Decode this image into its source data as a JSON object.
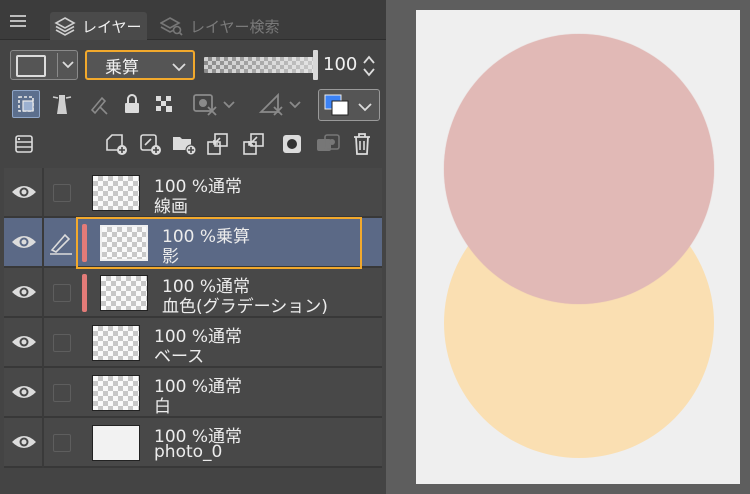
{
  "tabs": [
    {
      "label": "レイヤー",
      "active": true
    },
    {
      "label": "レイヤー検索",
      "active": false
    }
  ],
  "property": {
    "blend_mode": "乗算",
    "opacity": "100",
    "opacity_fraction": 1.0
  },
  "layers": [
    {
      "opacity_mode": "100 %通常",
      "name": "線画",
      "selected": false,
      "thumb": "checker"
    },
    {
      "opacity_mode": "100 %乗算",
      "name": "影",
      "selected": true,
      "thumb": "checker"
    },
    {
      "opacity_mode": "100 %通常",
      "name": "血色(グラデーション)",
      "selected": false,
      "thumb": "checker"
    },
    {
      "opacity_mode": "100 %通常",
      "name": "ベース",
      "selected": false,
      "thumb": "checker"
    },
    {
      "opacity_mode": "100 %通常",
      "name": "白",
      "selected": false,
      "thumb": "checker"
    },
    {
      "opacity_mode": "100 %通常",
      "name": "photo_0",
      "selected": false,
      "thumb": "solid"
    }
  ],
  "colors": {
    "accent": "#f2a92c",
    "selected_row": "#5b6986",
    "tag": "#e37b78",
    "paper": "#efefef",
    "shade_circle": "#e1b9b6",
    "base_circle": "#fadfb2"
  }
}
